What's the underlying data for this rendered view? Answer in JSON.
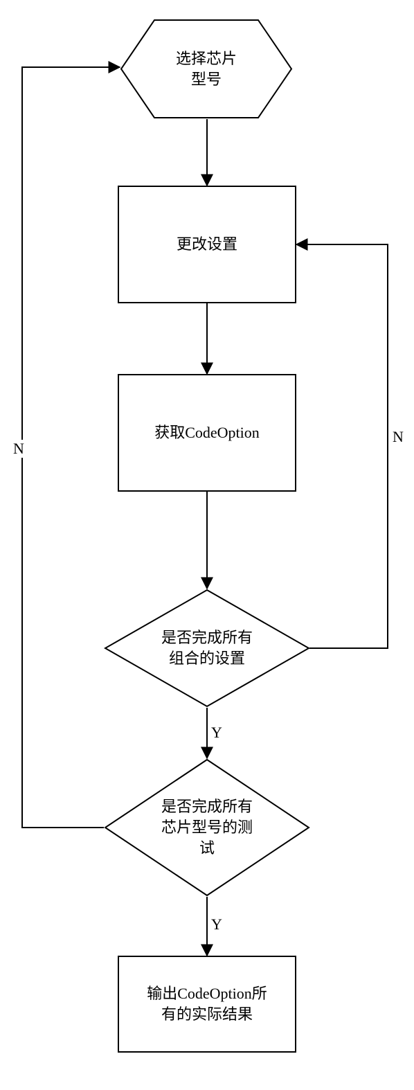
{
  "flowchart": {
    "nodes": {
      "start": "选择芯片\n型号",
      "change_settings": "更改设置",
      "get_codeoption": "获取CodeOption",
      "decision_all_combos": "是否完成所有\n组合的设置",
      "decision_all_chips": "是否完成所有\n芯片型号的测\n试",
      "output": "输出CodeOption所\n有的实际结果"
    },
    "edge_labels": {
      "combos_no": "N",
      "combos_yes": "Y",
      "chips_no": "N",
      "chips_yes": "Y"
    }
  }
}
